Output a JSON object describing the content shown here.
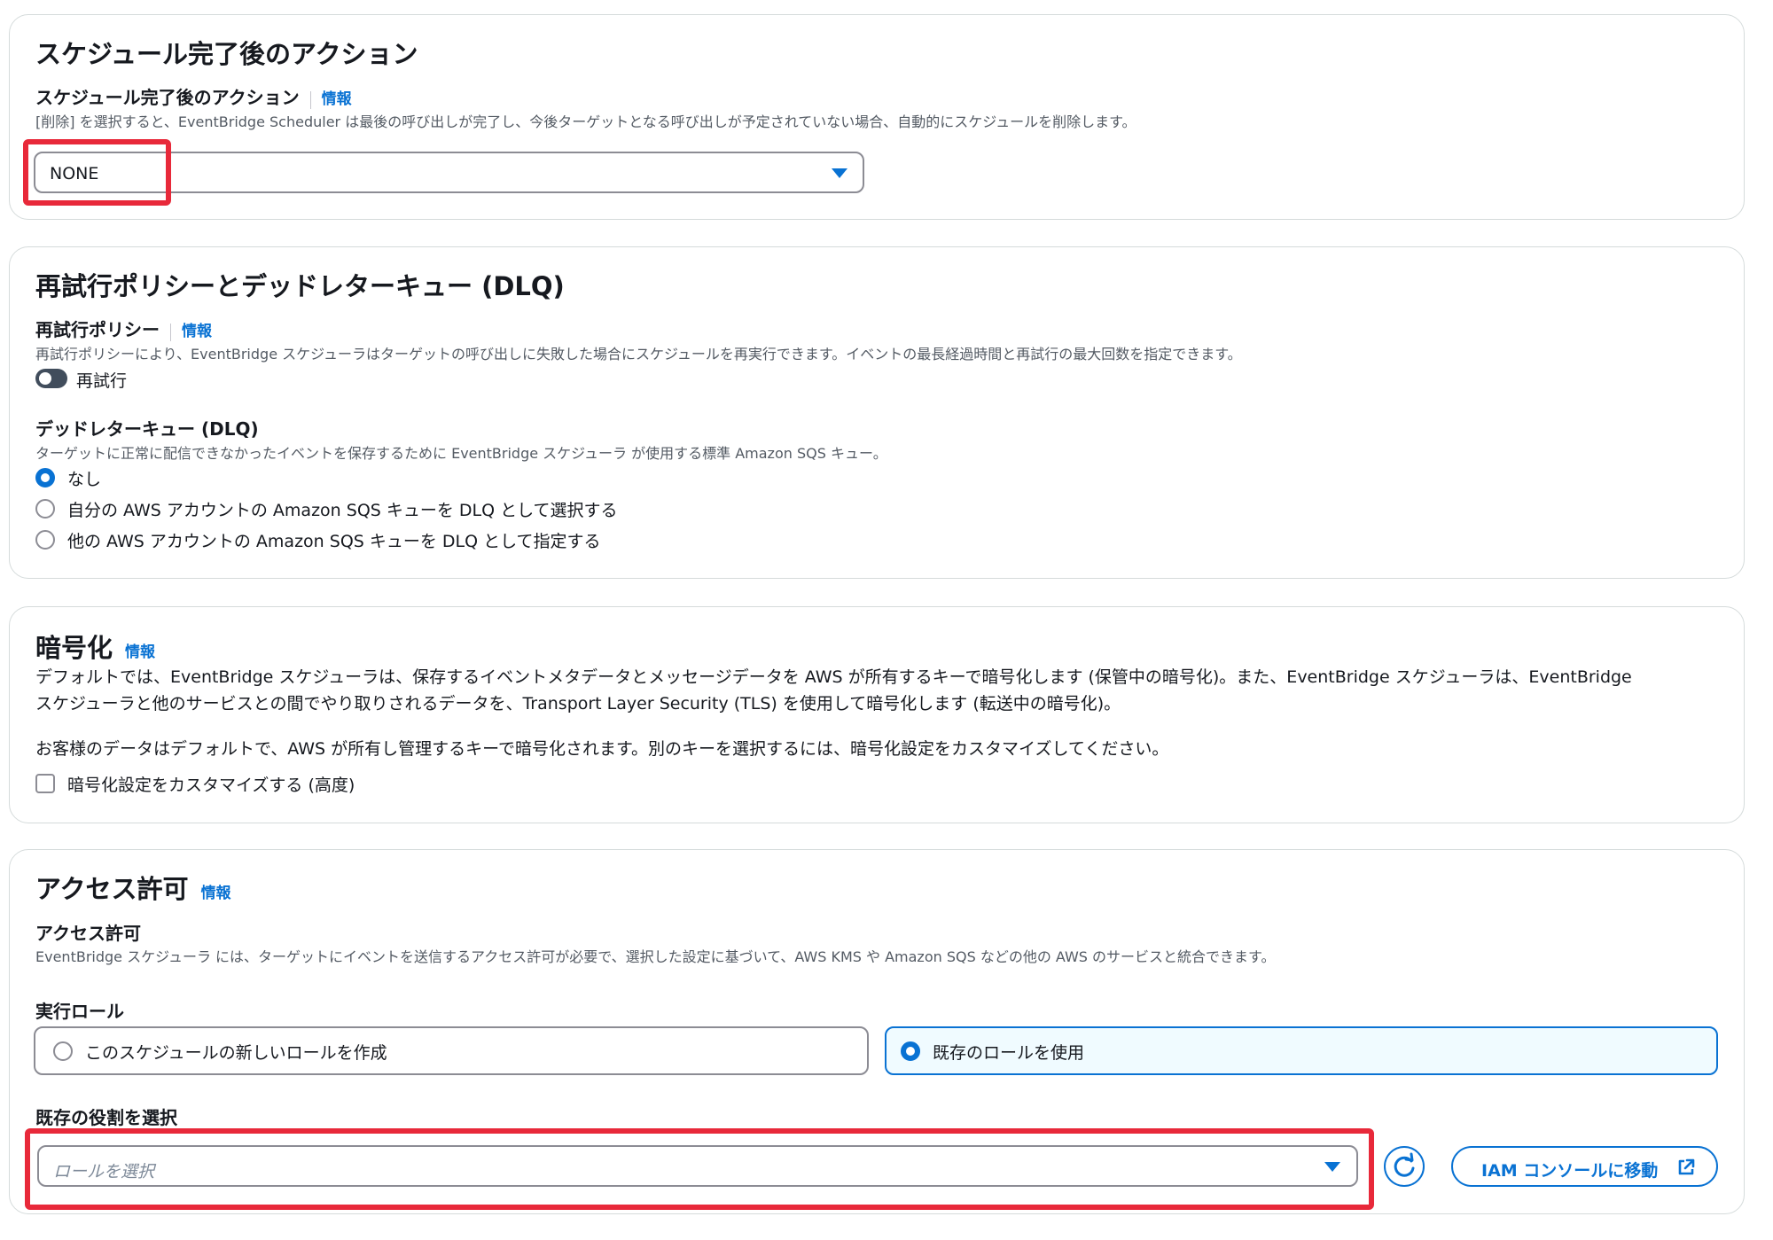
{
  "completion": {
    "title": "スケジュール完了後のアクション",
    "field_label": "スケジュール完了後のアクション",
    "info": "情報",
    "description": "[削除] を選択すると、EventBridge Scheduler は最後の呼び出しが完了し、今後ターゲットとなる呼び出しが予定されていない場合、自動的にスケジュールを削除します。",
    "selected_value": "NONE"
  },
  "retry": {
    "title": "再試行ポリシーとデッドレターキュー (DLQ)",
    "policy_label": "再試行ポリシー",
    "info": "情報",
    "policy_description": "再試行ポリシーにより、EventBridge スケジューラはターゲットの呼び出しに失敗した場合にスケジュールを再実行できます。イベントの最長経過時間と再試行の最大回数を指定できます。",
    "toggle_label": "再試行",
    "dlq_label": "デッドレターキュー (DLQ)",
    "dlq_description": "ターゲットに正常に配信できなかったイベントを保存するために EventBridge スケジューラ が使用する標準 Amazon SQS キュー。",
    "options": [
      "なし",
      "自分の AWS アカウントの Amazon SQS キューを DLQ として選択する",
      "他の AWS アカウントの Amazon SQS キューを DLQ として指定する"
    ]
  },
  "encryption": {
    "title": "暗号化",
    "info": "情報",
    "para1_line1": "デフォルトでは、EventBridge スケジューラは、保存するイベントメタデータとメッセージデータを AWS が所有するキーで暗号化します (保管中の暗号化)。また、EventBridge スケジューラは、EventBridge",
    "para1_line2": "スケジューラと他のサービスとの間でやり取りされるデータを、Transport Layer Security (TLS) を使用して暗号化します (転送中の暗号化)。",
    "para2": "お客様のデータはデフォルトで、AWS が所有し管理するキーで暗号化されます。別のキーを選択するには、暗号化設定をカスタマイズしてください。",
    "checkbox_label": "暗号化設定をカスタマイズする (高度)"
  },
  "access": {
    "title": "アクセス許可",
    "info": "情報",
    "sub_label": "アクセス許可",
    "description": "EventBridge スケジューラ には、ターゲットにイベントを送信するアクセス許可が必要で、選択した設定に基づいて、AWS KMS や Amazon SQS などの他の AWS のサービスと統合できます。",
    "role_label": "実行ロール",
    "role_options": [
      "このスケジュールの新しいロールを作成",
      "既存のロールを使用"
    ],
    "existing_label": "既存の役割を選択",
    "role_placeholder": "ロールを選択",
    "iam_button": "IAM コンソールに移動"
  },
  "colors": {
    "accent": "#0972d3",
    "highlight": "#e8293a",
    "selected_tile_bg": "#f0fbff"
  }
}
